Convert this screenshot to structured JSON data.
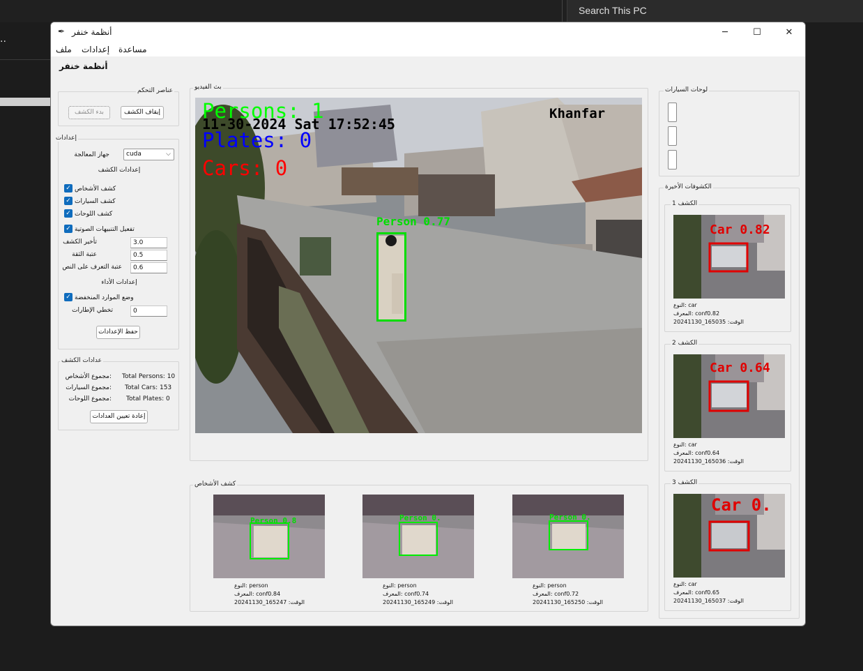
{
  "desktop": {
    "search_placeholder": "Search This PC",
    "left_snippet": ".."
  },
  "window": {
    "title": "أنظمة خنفر",
    "icon": "feather-icon",
    "minimize": "─",
    "maximize": "☐",
    "close": "✕"
  },
  "menu": {
    "file": "ملف",
    "settings": "إعدادات",
    "help": "مساعدة"
  },
  "header": {
    "title": "أنظمة خنفر"
  },
  "controls": {
    "title": "عناصر التحكم",
    "start_label": "بدء الكشف",
    "stop_label": "إيقاف الكشف"
  },
  "settings": {
    "title": "إعدادات",
    "device_label": "جهاز المعالجة",
    "device_value": "cuda",
    "detection_header": "إعدادات الكشف",
    "checks": [
      {
        "label": "كشف الأشخاص",
        "checked": true
      },
      {
        "label": "كشف السيارات",
        "checked": true
      },
      {
        "label": "كشف اللوحات",
        "checked": true
      },
      {
        "label": "تفعيل التنبيهات الصوتية",
        "checked": true
      }
    ],
    "fields": [
      {
        "label": "تأخير الكشف",
        "value": "3.0"
      },
      {
        "label": "عتبة الثقة",
        "value": "0.5"
      },
      {
        "label": "عتبة التعرف على النص",
        "value": "0.6"
      }
    ],
    "performance_header": "إعدادات الأداء",
    "low_resource_label": "وضع الموارد المنخفضة",
    "frame_skip_label": "تخطي الإطارات",
    "frame_skip_value": "0",
    "save_label": "حفظ الإعدادات"
  },
  "counters": {
    "title": "عدادات الكشف",
    "rows": [
      {
        "label": "مجموع الأشخاص:",
        "value": "Total Persons: 10"
      },
      {
        "label": "مجموع السيارات:",
        "value": "Total Cars: 153"
      },
      {
        "label": "مجموع اللوحات:",
        "value": "Total Plates: 0"
      }
    ],
    "reset_label": "إعادة تعيين العدادات"
  },
  "video": {
    "title": "بث الفيديو",
    "persons_text": "Persons: 1",
    "timestamp": "11-30-2024 Sat 17:52:45",
    "plates_text": "Plates: 0",
    "cars_text": "Cars: 0",
    "brand_text": "Khanfar",
    "box_label": "Person 0.77"
  },
  "plates": {
    "title": "لوحات السيارات"
  },
  "recent": {
    "title": "الكشوفات الأخيرة",
    "items": [
      {
        "title": "الكشف 1",
        "overlay": "Car 0.82",
        "type": "النوع: car",
        "id": "المعرف: conf0.82",
        "time": "الوقت: 165035_20241130"
      },
      {
        "title": "الكشف 2",
        "overlay": "Car 0.64",
        "type": "النوع: car",
        "id": "المعرف: conf0.64",
        "time": "الوقت: 165036_20241130"
      },
      {
        "title": "الكشف 3",
        "overlay": "Car 0.",
        "type": "النوع: car",
        "id": "المعرف: conf0.65",
        "time": "الوقت: 165037_20241130"
      }
    ]
  },
  "persons": {
    "title": "كشف الأشخاص",
    "items": [
      {
        "overlay": "Person 0.8",
        "type": "النوع: person",
        "id": "المعرف: conf0.84",
        "time": "الوقت: 165247_20241130"
      },
      {
        "overlay": "Person 0.",
        "type": "النوع: person",
        "id": "المعرف: conf0.74",
        "time": "الوقت: 165249_20241130"
      },
      {
        "overlay": "Person 0.",
        "type": "النوع: person",
        "id": "المعرف: conf0.72",
        "time": "الوقت: 165250_20241130"
      }
    ]
  }
}
